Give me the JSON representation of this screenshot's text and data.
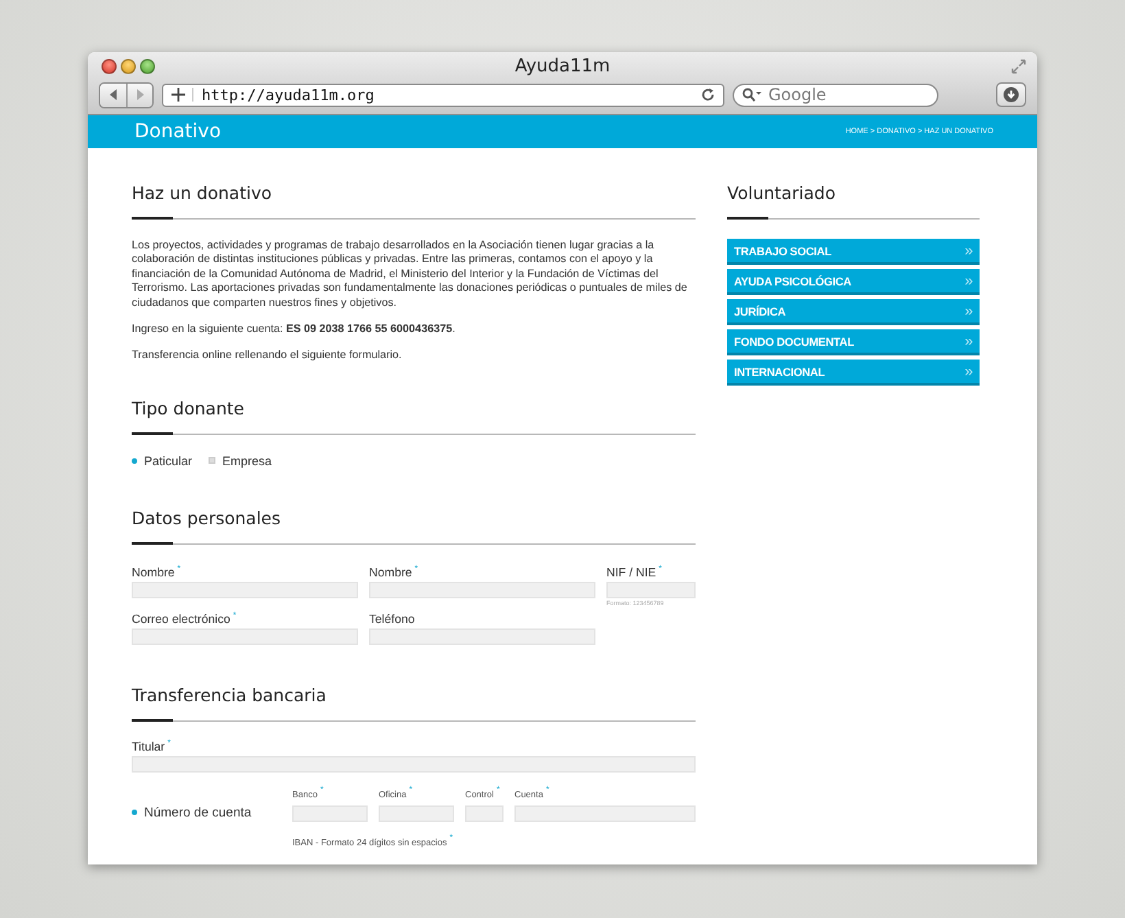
{
  "browser": {
    "title": "Ayuda11m",
    "url": "http://ayuda11m.org",
    "search_placeholder": "Google"
  },
  "header": {
    "title": "Donativo",
    "breadcrumb": "HOME > DONATIVO > HAZ UN DONATIVO"
  },
  "main": {
    "title": "Haz un donativo",
    "paragraphs": [
      "Los proyectos, actividades y programas de trabajo desarrollados en la Asociación tienen lugar gracias a la colaboración de distintas instituciones públicas y privadas. Entre las primeras, contamos con el apoyo y la financiación de la Comunidad Autónoma de Madrid, el Ministerio del Interior y la Fundación de Víctimas del Terrorismo. Las aportaciones privadas son fundamentalmente las donaciones periódicas o puntuales de miles de ciudadanos que comparten nuestros fines y objetivos.",
      "Ingreso en la siguiente cuenta: **ES 09 2038 1766 55 6000436375**.",
      "Transferencia online rellenando el siguiente formulario."
    ]
  },
  "donor_type": {
    "title": "Tipo donante",
    "options": [
      {
        "label": "Paticular",
        "selected": true
      },
      {
        "label": "Empresa",
        "selected": false
      }
    ]
  },
  "personal": {
    "title": "Datos personales",
    "rows": [
      [
        {
          "label": "Nombre",
          "mark": "*"
        },
        {
          "label": "Nombre",
          "mark": "*"
        },
        {
          "label": "NIF / NIE",
          "mark": "*",
          "hint": "Formato: 123456789"
        }
      ],
      [
        {
          "label": "Correo electrónico",
          "mark": "*"
        },
        {
          "label": "Teléfono"
        }
      ]
    ]
  },
  "bank": {
    "title": "Transferencia bancaria",
    "holder": {
      "label": "Titular",
      "mark": "*"
    },
    "account": {
      "label": "Número de cuenta",
      "selected": true,
      "fields": [
        {
          "label": "Banco",
          "mark": "*"
        },
        {
          "label": "Oficina",
          "mark": "*"
        },
        {
          "label": "Control",
          "mark": "*"
        },
        {
          "label": "Cuenta",
          "mark": "*"
        }
      ]
    },
    "iban": {
      "label": "IBAN - Formato 24 dígitos sin espacios",
      "mark": "*"
    }
  },
  "sidebar": {
    "title": "Voluntariado",
    "items": [
      {
        "label": "TRABAJO SOCIAL",
        "arrow": "»"
      },
      {
        "label": "AYUDA PSICOLÓGICA",
        "arrow": "»"
      },
      {
        "label": "JURÍDICA",
        "arrow": "»"
      },
      {
        "label": "FONDO DOCUMENTAL",
        "arrow": "»"
      },
      {
        "label": "INTERNACIONAL",
        "arrow": "»"
      }
    ]
  }
}
